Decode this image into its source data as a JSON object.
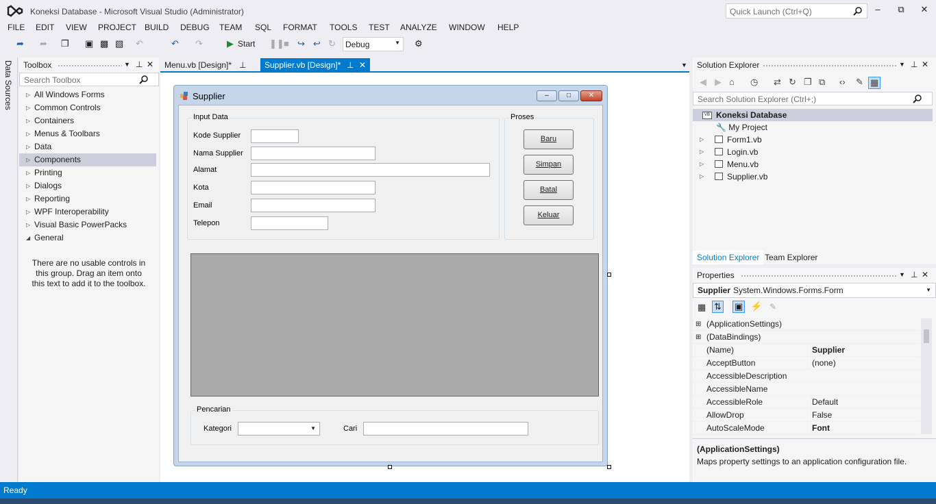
{
  "window": {
    "title": "Koneksi Database - Microsoft Visual Studio (Administrator)",
    "quick_launch_placeholder": "Quick Launch (Ctrl+Q)"
  },
  "menu": [
    "FILE",
    "EDIT",
    "VIEW",
    "PROJECT",
    "BUILD",
    "DEBUG",
    "TEAM",
    "SQL",
    "FORMAT",
    "TOOLS",
    "TEST",
    "ANALYZE",
    "WINDOW",
    "HELP"
  ],
  "toolbar": {
    "start_label": "Start",
    "config": "Debug"
  },
  "left_strip": {
    "data_sources": "Data Sources"
  },
  "toolbox": {
    "title": "Toolbox",
    "search_placeholder": "Search Toolbox",
    "items": [
      "All Windows Forms",
      "Common Controls",
      "Containers",
      "Menus & Toolbars",
      "Data",
      "Components",
      "Printing",
      "Dialogs",
      "Reporting",
      "WPF Interoperability",
      "Visual Basic PowerPacks",
      "General"
    ],
    "selected": "Components",
    "empty_message": "There are no usable controls in this group. Drag an item onto this text to add it to the toolbox."
  },
  "tabs": [
    {
      "label": "Menu.vb [Design]*",
      "active": false
    },
    {
      "label": "Supplier.vb [Design]*",
      "active": true
    }
  ],
  "form": {
    "title": "Supplier",
    "input_group": "Input Data",
    "fields": [
      {
        "label": "Kode Supplier",
        "value": ""
      },
      {
        "label": "Nama Supplier",
        "value": ""
      },
      {
        "label": "Alamat",
        "value": ""
      },
      {
        "label": "Kota",
        "value": ""
      },
      {
        "label": "Email",
        "value": ""
      },
      {
        "label": "Telepon",
        "value": ""
      }
    ],
    "proses_group": "Proses",
    "buttons": [
      "Baru",
      "Simpan",
      "Batal",
      "Keluar"
    ],
    "search_group": "Pencarian",
    "kategori_label": "Kategori",
    "kategori_value": "",
    "cari_label": "Cari",
    "cari_value": ""
  },
  "solution_explorer": {
    "title": "Solution Explorer",
    "search_placeholder": "Search Solution Explorer (Ctrl+;)",
    "root": "Koneksi Database",
    "items": [
      "My Project",
      "Form1.vb",
      "Login.vb",
      "Menu.vb",
      "Supplier.vb"
    ],
    "tabs": [
      "Solution Explorer",
      "Team Explorer"
    ]
  },
  "properties": {
    "title": "Properties",
    "object_name": "Supplier",
    "object_type": "System.Windows.Forms.Form",
    "rows": [
      {
        "name": "(ApplicationSettings)",
        "value": "",
        "expand": "⊞"
      },
      {
        "name": "(DataBindings)",
        "value": "",
        "expand": "⊞"
      },
      {
        "name": "(Name)",
        "value": "Supplier",
        "expand": ""
      },
      {
        "name": "AcceptButton",
        "value": "(none)",
        "expand": ""
      },
      {
        "name": "AccessibleDescription",
        "value": "",
        "expand": ""
      },
      {
        "name": "AccessibleName",
        "value": "",
        "expand": ""
      },
      {
        "name": "AccessibleRole",
        "value": "Default",
        "expand": ""
      },
      {
        "name": "AllowDrop",
        "value": "False",
        "expand": ""
      },
      {
        "name": "AutoScaleMode",
        "value": "Font",
        "expand": ""
      }
    ],
    "desc_title": "(ApplicationSettings)",
    "desc_text": "Maps property settings to an application configuration file."
  },
  "status": {
    "text": "Ready"
  },
  "colors": {
    "accent": "#007acc",
    "background": "#eeeef2"
  }
}
